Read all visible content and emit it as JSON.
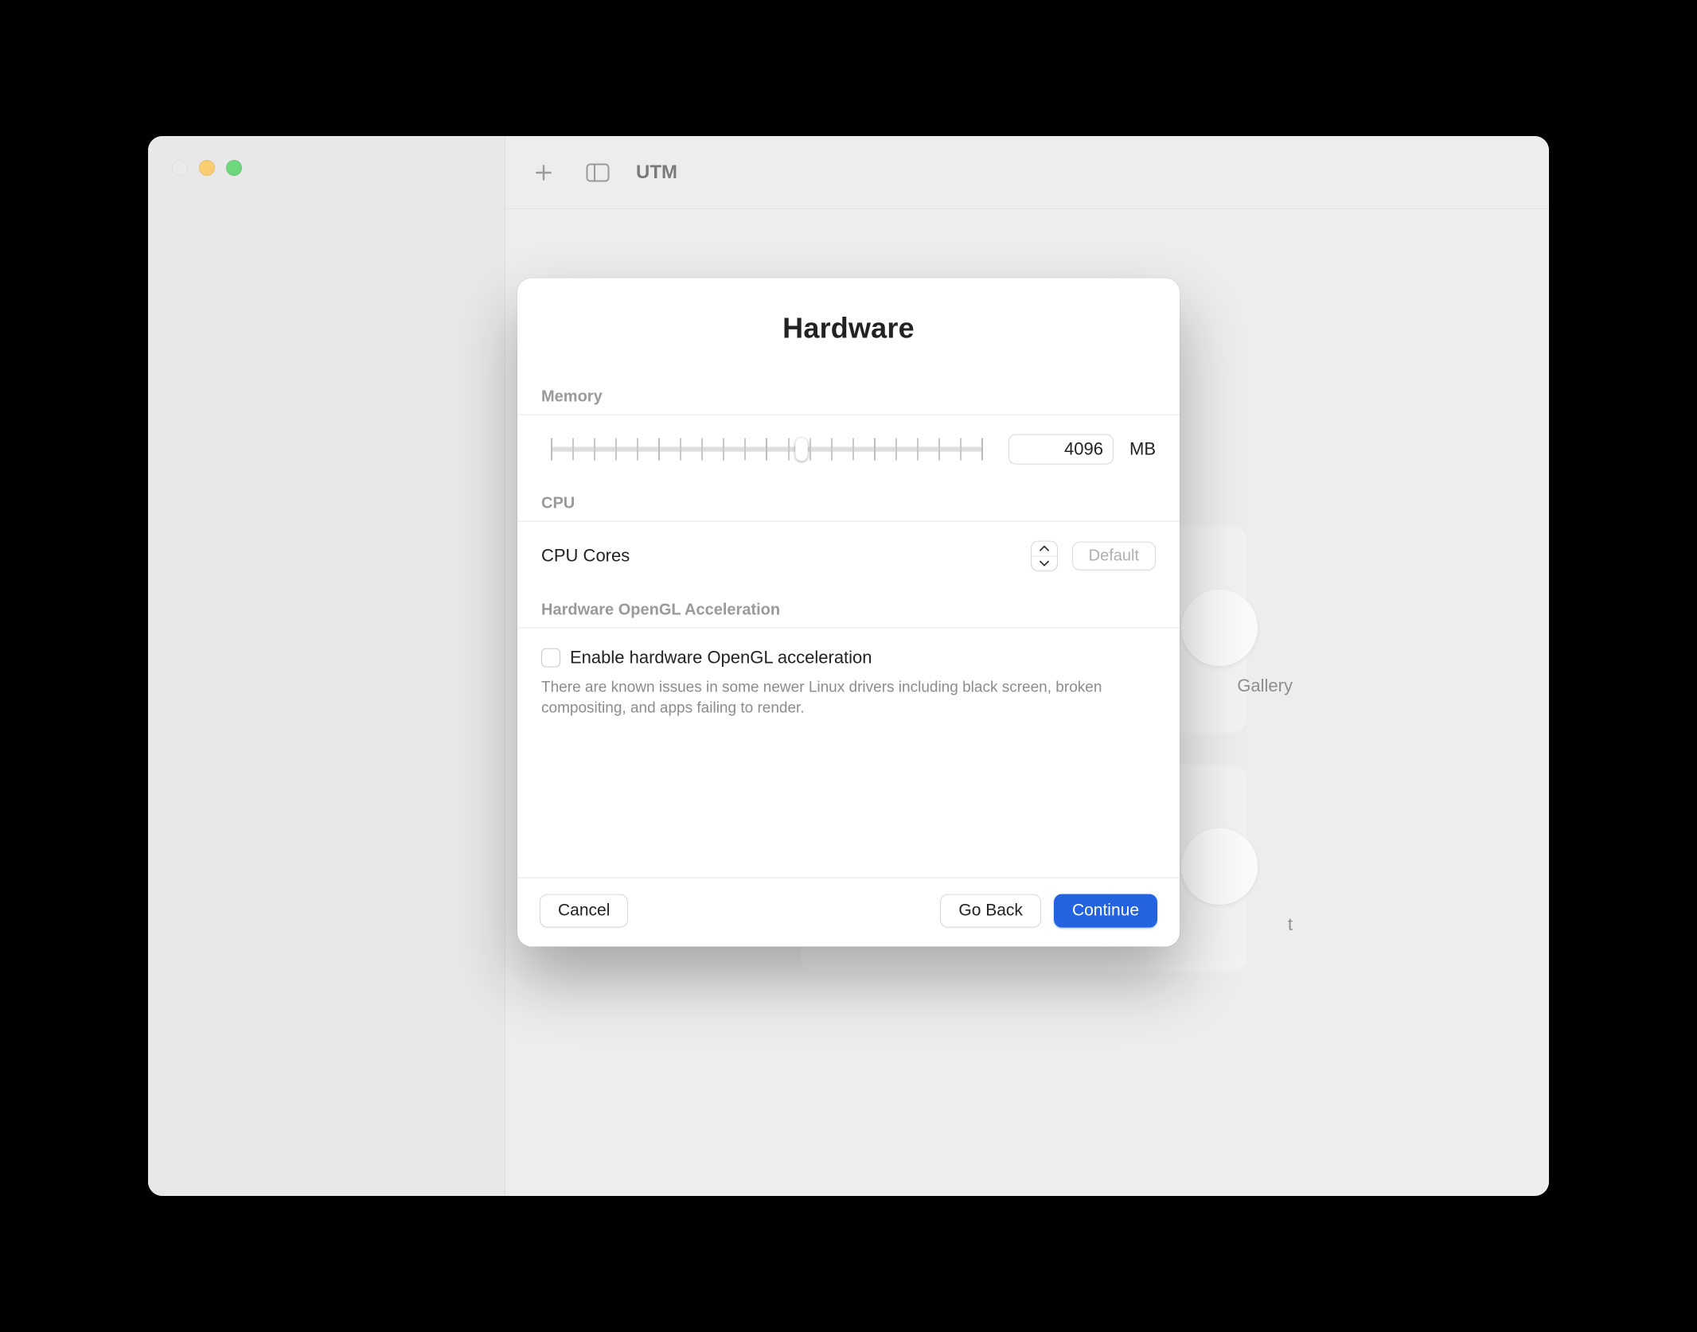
{
  "app": {
    "title": "UTM"
  },
  "background": {
    "card1_caption": "Gallery",
    "card2_caption": "t"
  },
  "modal": {
    "title": "Hardware",
    "memory": {
      "section_label": "Memory",
      "value": "4096",
      "unit": "MB",
      "slider_percent": 58
    },
    "cpu": {
      "section_label": "CPU",
      "label": "CPU Cores",
      "default_button": "Default"
    },
    "opengl": {
      "section_label": "Hardware OpenGL Acceleration",
      "checkbox_label": "Enable hardware OpenGL acceleration",
      "checked": false,
      "help": "There are known issues in some newer Linux drivers including black screen, broken compositing, and apps failing to render."
    },
    "buttons": {
      "cancel": "Cancel",
      "back": "Go Back",
      "continue": "Continue"
    }
  }
}
